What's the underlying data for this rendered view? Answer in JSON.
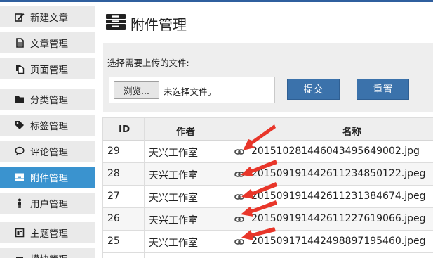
{
  "sidebar": {
    "items": [
      {
        "label": "新建文章",
        "icon": "edit-icon"
      },
      {
        "label": "文章管理",
        "icon": "document-icon"
      },
      {
        "label": "页面管理",
        "icon": "pages-icon"
      },
      {
        "label": "分类管理",
        "icon": "folder-icon"
      },
      {
        "label": "标签管理",
        "icon": "tag-icon"
      },
      {
        "label": "评论管理",
        "icon": "comment-icon"
      },
      {
        "label": "附件管理",
        "icon": "archive-icon",
        "active": true
      },
      {
        "label": "用户管理",
        "icon": "user-icon"
      },
      {
        "label": "主题管理",
        "icon": "layout-icon"
      },
      {
        "label": "模块管理",
        "icon": "module-icon"
      }
    ]
  },
  "page": {
    "title": "附件管理",
    "title_icon": "archive-icon"
  },
  "upload": {
    "label": "选择需要上传的文件:",
    "browse_label": "浏览...",
    "file_status": "未选择文件。",
    "submit_label": "提交",
    "reset_label": "重置"
  },
  "table": {
    "headers": {
      "id": "ID",
      "author": "作者",
      "name": "名称"
    },
    "rows": [
      {
        "id": "29",
        "author": "天兴工作室",
        "name": "20151028144604349564​9002.jpg"
      },
      {
        "id": "28",
        "author": "天兴工作室",
        "name": "20150919144261123485​0122.jpeg"
      },
      {
        "id": "27",
        "author": "天兴工作室",
        "name": "20150919144261123138​4674.jpeg"
      },
      {
        "id": "26",
        "author": "天兴工作室",
        "name": "20150919144261122761​9066.jpeg"
      },
      {
        "id": "25",
        "author": "天兴工作室",
        "name": "20150917144249889719​5460.jpeg"
      }
    ]
  },
  "colors": {
    "accent": "#3a93cf",
    "button": "#3b72ab",
    "arrow": "#e8362a"
  }
}
